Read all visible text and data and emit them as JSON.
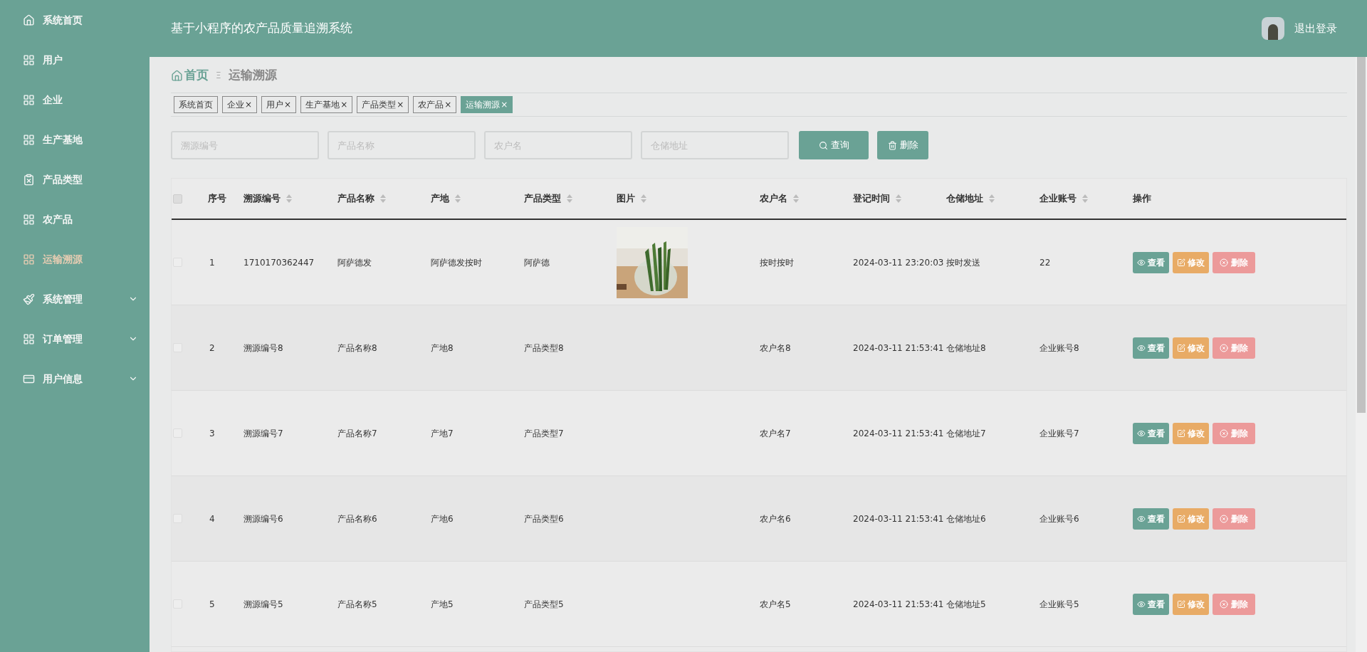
{
  "header": {
    "title": "基于小程序的农产品质量追溯系统",
    "logout": "退出登录"
  },
  "sidebar": {
    "items": [
      {
        "label": "系统首页",
        "kind": "home",
        "selected": false,
        "has_submenu": false
      },
      {
        "label": "用户",
        "kind": "grid",
        "selected": false,
        "has_submenu": false
      },
      {
        "label": "企业",
        "kind": "grid",
        "selected": false,
        "has_submenu": false
      },
      {
        "label": "生产基地",
        "kind": "grid",
        "selected": false,
        "has_submenu": false
      },
      {
        "label": "产品类型",
        "kind": "clipboard",
        "selected": false,
        "has_submenu": false
      },
      {
        "label": "农产品",
        "kind": "grid",
        "selected": false,
        "has_submenu": false
      },
      {
        "label": "运输溯源",
        "kind": "grid",
        "selected": true,
        "has_submenu": false
      },
      {
        "label": "系统管理",
        "kind": "brush",
        "selected": false,
        "has_submenu": true
      },
      {
        "label": "订单管理",
        "kind": "grid",
        "selected": false,
        "has_submenu": true
      },
      {
        "label": "用户信息",
        "kind": "card",
        "selected": false,
        "has_submenu": true
      }
    ]
  },
  "breadcrumb": {
    "home": "首页",
    "separator": "Ξ",
    "current": "运输溯源"
  },
  "tags": [
    {
      "label": "系统首页",
      "closable": false,
      "selected": false
    },
    {
      "label": "企业",
      "closable": true,
      "selected": false
    },
    {
      "label": "用户",
      "closable": true,
      "selected": false
    },
    {
      "label": "生产基地",
      "closable": true,
      "selected": false
    },
    {
      "label": "产品类型",
      "closable": true,
      "selected": false
    },
    {
      "label": "农产品",
      "closable": true,
      "selected": false
    },
    {
      "label": "运输溯源",
      "closable": true,
      "selected": true
    }
  ],
  "close_mark": "×",
  "search": {
    "fields": [
      {
        "placeholder": "溯源编号"
      },
      {
        "placeholder": "产品名称"
      },
      {
        "placeholder": "农户名"
      },
      {
        "placeholder": "仓储地址"
      }
    ],
    "query_button": "查询",
    "delete_button": "删除"
  },
  "table": {
    "all_checked": false,
    "columns": [
      {
        "label": "序号",
        "sortable": false
      },
      {
        "label": "溯源编号",
        "sortable": true
      },
      {
        "label": "产品名称",
        "sortable": true
      },
      {
        "label": "产地",
        "sortable": true
      },
      {
        "label": "产品类型",
        "sortable": true
      },
      {
        "label": "图片",
        "sortable": true
      },
      {
        "label": "农户名",
        "sortable": true
      },
      {
        "label": "登记时间",
        "sortable": true
      },
      {
        "label": "仓储地址",
        "sortable": true
      },
      {
        "label": "企业账号",
        "sortable": true
      },
      {
        "label": "操作",
        "sortable": false
      }
    ],
    "rows": [
      {
        "cells": [
          "1",
          "1710170362447",
          "阿萨德发",
          "阿萨德发按时",
          "阿萨德"
        ],
        "picture": true,
        "cells2": [
          "按时按时",
          "2024-03-11 23:20:03",
          "按时发送",
          "22"
        ],
        "checked": false,
        "actions": {
          "view": "查看",
          "edit": "修改",
          "delete": "删除"
        }
      },
      {
        "cells": [
          "2",
          "溯源编号8",
          "产品名称8",
          "产地8",
          "产品类型8"
        ],
        "picture": false,
        "cells2": [
          "农户名8",
          "2024-03-11 21:53:41",
          "仓储地址8",
          "企业账号8"
        ],
        "checked": false,
        "actions": {
          "view": "查看",
          "edit": "修改",
          "delete": "删除"
        }
      },
      {
        "cells": [
          "3",
          "溯源编号7",
          "产品名称7",
          "产地7",
          "产品类型7"
        ],
        "picture": false,
        "cells2": [
          "农户名7",
          "2024-03-11 21:53:41",
          "仓储地址7",
          "企业账号7"
        ],
        "checked": false,
        "actions": {
          "view": "查看",
          "edit": "修改",
          "delete": "删除"
        }
      },
      {
        "cells": [
          "4",
          "溯源编号6",
          "产品名称6",
          "产地6",
          "产品类型6"
        ],
        "picture": false,
        "cells2": [
          "农户名6",
          "2024-03-11 21:53:41",
          "仓储地址6",
          "企业账号6"
        ],
        "checked": false,
        "actions": {
          "view": "查看",
          "edit": "修改",
          "delete": "删除"
        }
      },
      {
        "cells": [
          "5",
          "溯源编号5",
          "产品名称5",
          "产地5",
          "产品类型5"
        ],
        "picture": false,
        "cells2": [
          "农户名5",
          "2024-03-11 21:53:41",
          "仓储地址5",
          "企业账号5"
        ],
        "checked": false,
        "actions": {
          "view": "查看",
          "edit": "修改",
          "delete": "删除"
        }
      }
    ]
  }
}
